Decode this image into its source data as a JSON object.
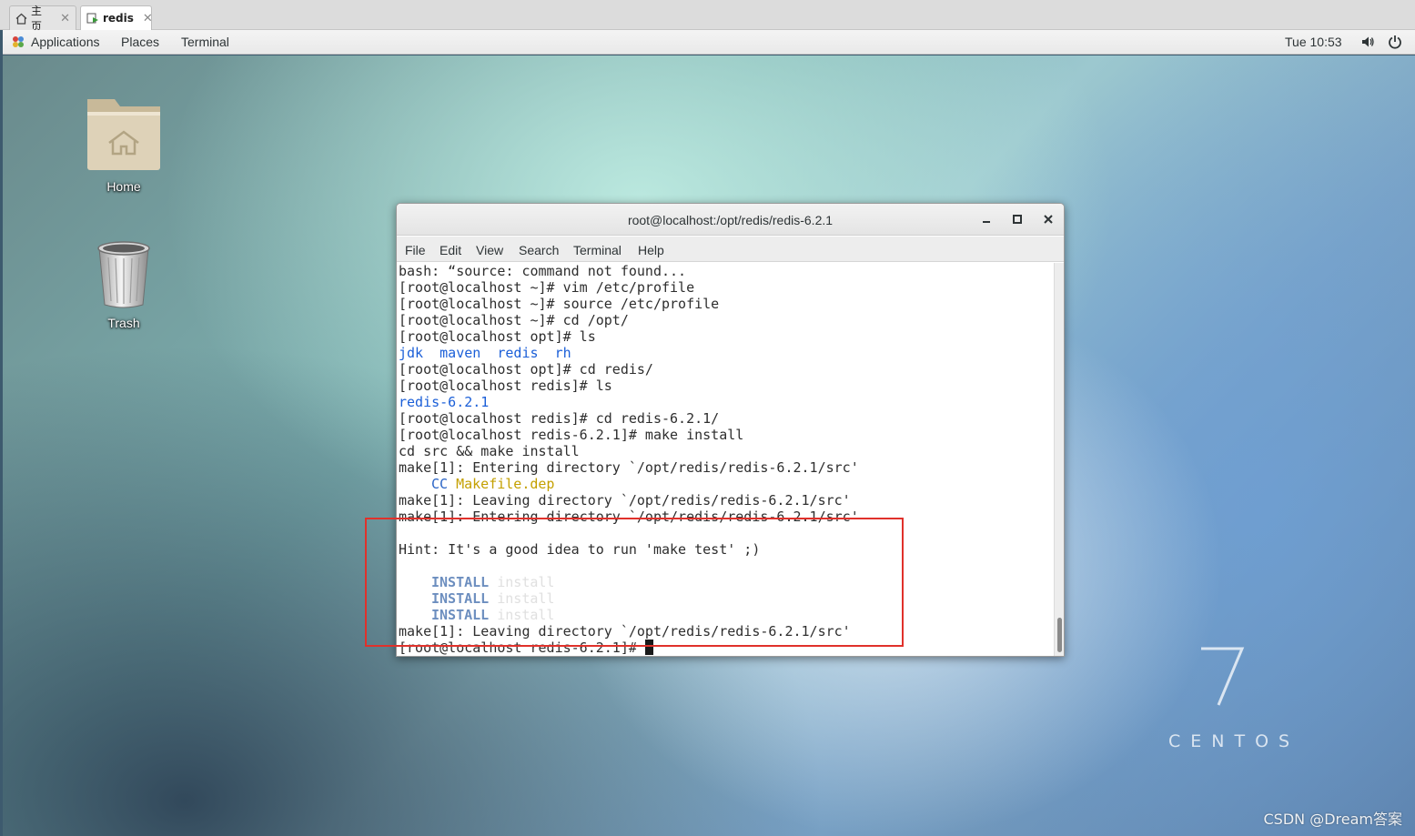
{
  "tabs": [
    {
      "label": "主页",
      "icon": "home-icon",
      "close": "✕"
    },
    {
      "label": "redis",
      "icon": "vm-icon",
      "close": "✕"
    }
  ],
  "top_panel": {
    "applications": "Applications",
    "places": "Places",
    "terminal": "Terminal",
    "clock": "Tue 10:53",
    "volume_icon": "volume-icon",
    "power_icon": "power-icon"
  },
  "desktop": {
    "home_label": "Home",
    "trash_label": "Trash",
    "centos_number": "7",
    "centos_text": "CENTOS",
    "watermark": "CSDN @Dream答案"
  },
  "terminal_window": {
    "title": "root@localhost:/opt/redis/redis-6.2.1",
    "controls": {
      "minimize": "minimize-icon",
      "maximize": "maximize-icon",
      "close": "close-icon"
    },
    "menu": [
      "File",
      "Edit",
      "View",
      "Search",
      "Terminal",
      "Help"
    ],
    "lines": [
      "bash: “source: command not found...",
      "[root@localhost ~]# vim /etc/profile",
      "[root@localhost ~]# source /etc/profile",
      "[root@localhost ~]# cd /opt/",
      "[root@localhost opt]# ls",
      "jdk  maven  redis  rh",
      "[root@localhost opt]# cd redis/",
      "[root@localhost redis]# ls",
      "redis-6.2.1",
      "[root@localhost redis]# cd redis-6.2.1/",
      "[root@localhost redis-6.2.1]# make install",
      "cd src && make install",
      "make[1]: Entering directory `/opt/redis/redis-6.2.1/src'",
      "CC",
      "Makefile.dep",
      "make[1]: Leaving directory `/opt/redis/redis-6.2.1/src'",
      "make[1]: Entering directory `/opt/redis/redis-6.2.1/src'",
      "Hint: It's a good idea to run 'make test' ;)",
      "INSTALL",
      "install",
      "make[1]: Leaving directory `/opt/redis/redis-6.2.1/src'",
      "[root@localhost redis-6.2.1]# "
    ]
  },
  "colors": {
    "highlight_box": "#e0312b",
    "dir_blue": "#1b5fd8",
    "makefile_yellow": "#c4a000",
    "install_blue": "#6c8ebf"
  }
}
